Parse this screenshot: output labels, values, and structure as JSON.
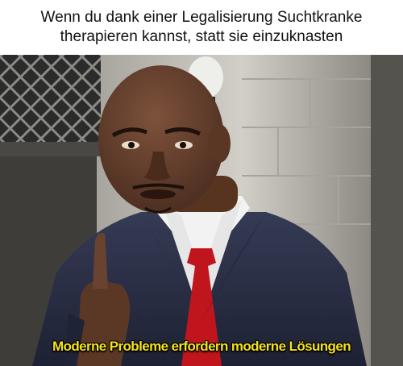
{
  "meme": {
    "top_caption": "Wenn du dank einer Legalisierung Suchtkranke\ntherapieren kannst, statt sie einzuknasten",
    "bottom_caption": "Moderne Probleme erfordern moderne Lösungen"
  },
  "colors": {
    "caption_text": "#111111",
    "bottom_caption_text": "#f4e21a",
    "suit": "#2c3148",
    "tie": "#c0151c",
    "shirt": "#f2f2f2",
    "skin": "#6b4330",
    "wall": "#c9c6c0"
  }
}
